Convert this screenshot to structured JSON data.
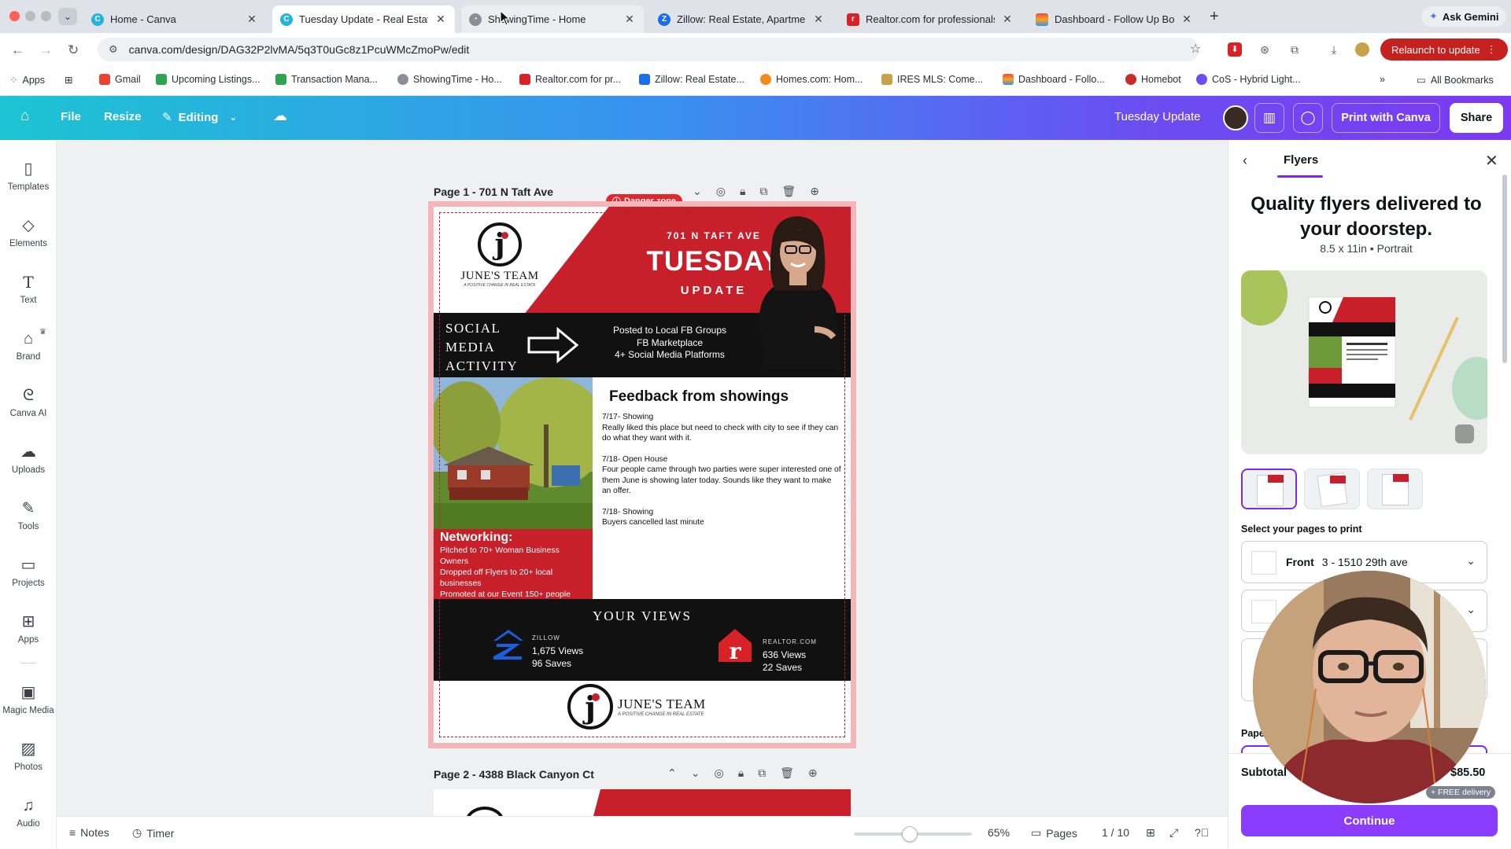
{
  "browser": {
    "tabs": [
      {
        "label": "Home - Canva",
        "favicon": "canva-icon"
      },
      {
        "label": "Tuesday Update - Real Estate",
        "favicon": "canva-icon"
      },
      {
        "label": "ShowingTime - Home",
        "favicon": "showingtime-icon"
      },
      {
        "label": "Zillow: Real Estate, Apartmen",
        "favicon": "zillow-icon"
      },
      {
        "label": "Realtor.com for professionals",
        "favicon": "realtor-icon"
      },
      {
        "label": "Dashboard - Follow Up Boss",
        "favicon": "followupboss-icon"
      }
    ],
    "gemini_label": "Ask Gemini",
    "url": "canva.com/design/DAG32P2lvMA/5q3T0uGc8z1PcuWMcZmoPw/edit",
    "relaunch_label": "Relaunch to update",
    "bookmarks": [
      {
        "label": "Apps"
      },
      {
        "label": "Gmail"
      },
      {
        "label": "Upcoming Listings..."
      },
      {
        "label": "Transaction Mana..."
      },
      {
        "label": "ShowingTime - Ho..."
      },
      {
        "label": "Realtor.com for pr..."
      },
      {
        "label": "Zillow: Real Estate..."
      },
      {
        "label": "Homes.com: Hom..."
      },
      {
        "label": "IRES MLS: Come..."
      },
      {
        "label": "Dashboard - Follo..."
      },
      {
        "label": "Homebot"
      },
      {
        "label": "CoS - Hybrid Light..."
      }
    ],
    "all_bookmarks_label": "All Bookmarks"
  },
  "canva_header": {
    "file": "File",
    "resize": "Resize",
    "editing": "Editing",
    "design_title": "Tuesday Update",
    "print_label": "Print with Canva",
    "share_label": "Share"
  },
  "sidebar": {
    "items": [
      {
        "label": "Templates",
        "icon": "templates-icon"
      },
      {
        "label": "Elements",
        "icon": "elements-icon"
      },
      {
        "label": "Text",
        "icon": "text-icon"
      },
      {
        "label": "Brand",
        "icon": "brand-icon"
      },
      {
        "label": "Canva AI",
        "icon": "canva-ai-icon"
      },
      {
        "label": "Uploads",
        "icon": "uploads-icon"
      },
      {
        "label": "Tools",
        "icon": "tools-icon"
      },
      {
        "label": "Projects",
        "icon": "projects-icon"
      },
      {
        "label": "Apps",
        "icon": "apps-icon"
      },
      {
        "label": "Magic Media",
        "icon": "magic-media-icon"
      },
      {
        "label": "Photos",
        "icon": "photos-icon"
      },
      {
        "label": "Audio",
        "icon": "audio-icon"
      }
    ]
  },
  "canvas": {
    "page1_title": "Page 1 - 701 N Taft Ave",
    "danger_label": "Danger zone",
    "page2_title": "Page 2 - 4388 Black Canyon Ct"
  },
  "flyer": {
    "team_name": "JUNE'S TEAM",
    "team_tagline": "A POSITIVE CHANGE IN REAL ESTATE",
    "address": "701 N TAFT AVE",
    "headline": "TUESDAY",
    "subheadline": "UPDATE",
    "social_label": [
      "SOCIAL",
      "MEDIA",
      "ACTIVITY"
    ],
    "social_items": [
      "Posted to Local FB Groups",
      "FB Marketplace",
      "4+ Social Media Platforms"
    ],
    "networking_title": "Networking:",
    "networking_items": [
      "Pitched to 70+ Woman Business Owners",
      "Dropped off Flyers to 20+ local businesses",
      "Promoted at our Event 150+ people"
    ],
    "feedback_title": "Feedback from showings",
    "feedback": [
      {
        "date": "7/17- Showing",
        "text": "Really liked this place but need to check with city to see if they can do what they want with it."
      },
      {
        "date": "7/18- Open House",
        "text": "Four people came through two parties were super interested one of them June is showing later today. Sounds like they want to make an offer."
      },
      {
        "date": "7/18- Showing",
        "text": "Buyers cancelled last minute"
      }
    ],
    "views_title": "YOUR VIEWS",
    "zillow": {
      "source": "ZILLOW",
      "views": "1,675 Views",
      "saves": "96 Saves"
    },
    "realtor": {
      "source": "REALTOR.COM",
      "views": "636 Views",
      "saves": "22 Saves"
    }
  },
  "bottombar": {
    "notes": "Notes",
    "timer": "Timer",
    "zoom": "65%",
    "pages": "Pages",
    "page_count": "1 / 10"
  },
  "panel": {
    "title": "Flyers",
    "headline": "Quality flyers delivered to your doorstep.",
    "size": "8.5 x 11in • Portrait",
    "select_label": "Select your pages to print",
    "front_label": "Front",
    "front_value": "3 - 1510 29th ave",
    "paper_label": "Pape",
    "subtotal_label": "Subtotal",
    "subtotal_value": "$85.50",
    "free_delivery": "+ FREE delivery",
    "continue_label": "Continue"
  },
  "colors": {
    "brand_red": "#c7202b",
    "canva_purple": "#8b3dff",
    "relaunch_red": "#c5221f"
  }
}
